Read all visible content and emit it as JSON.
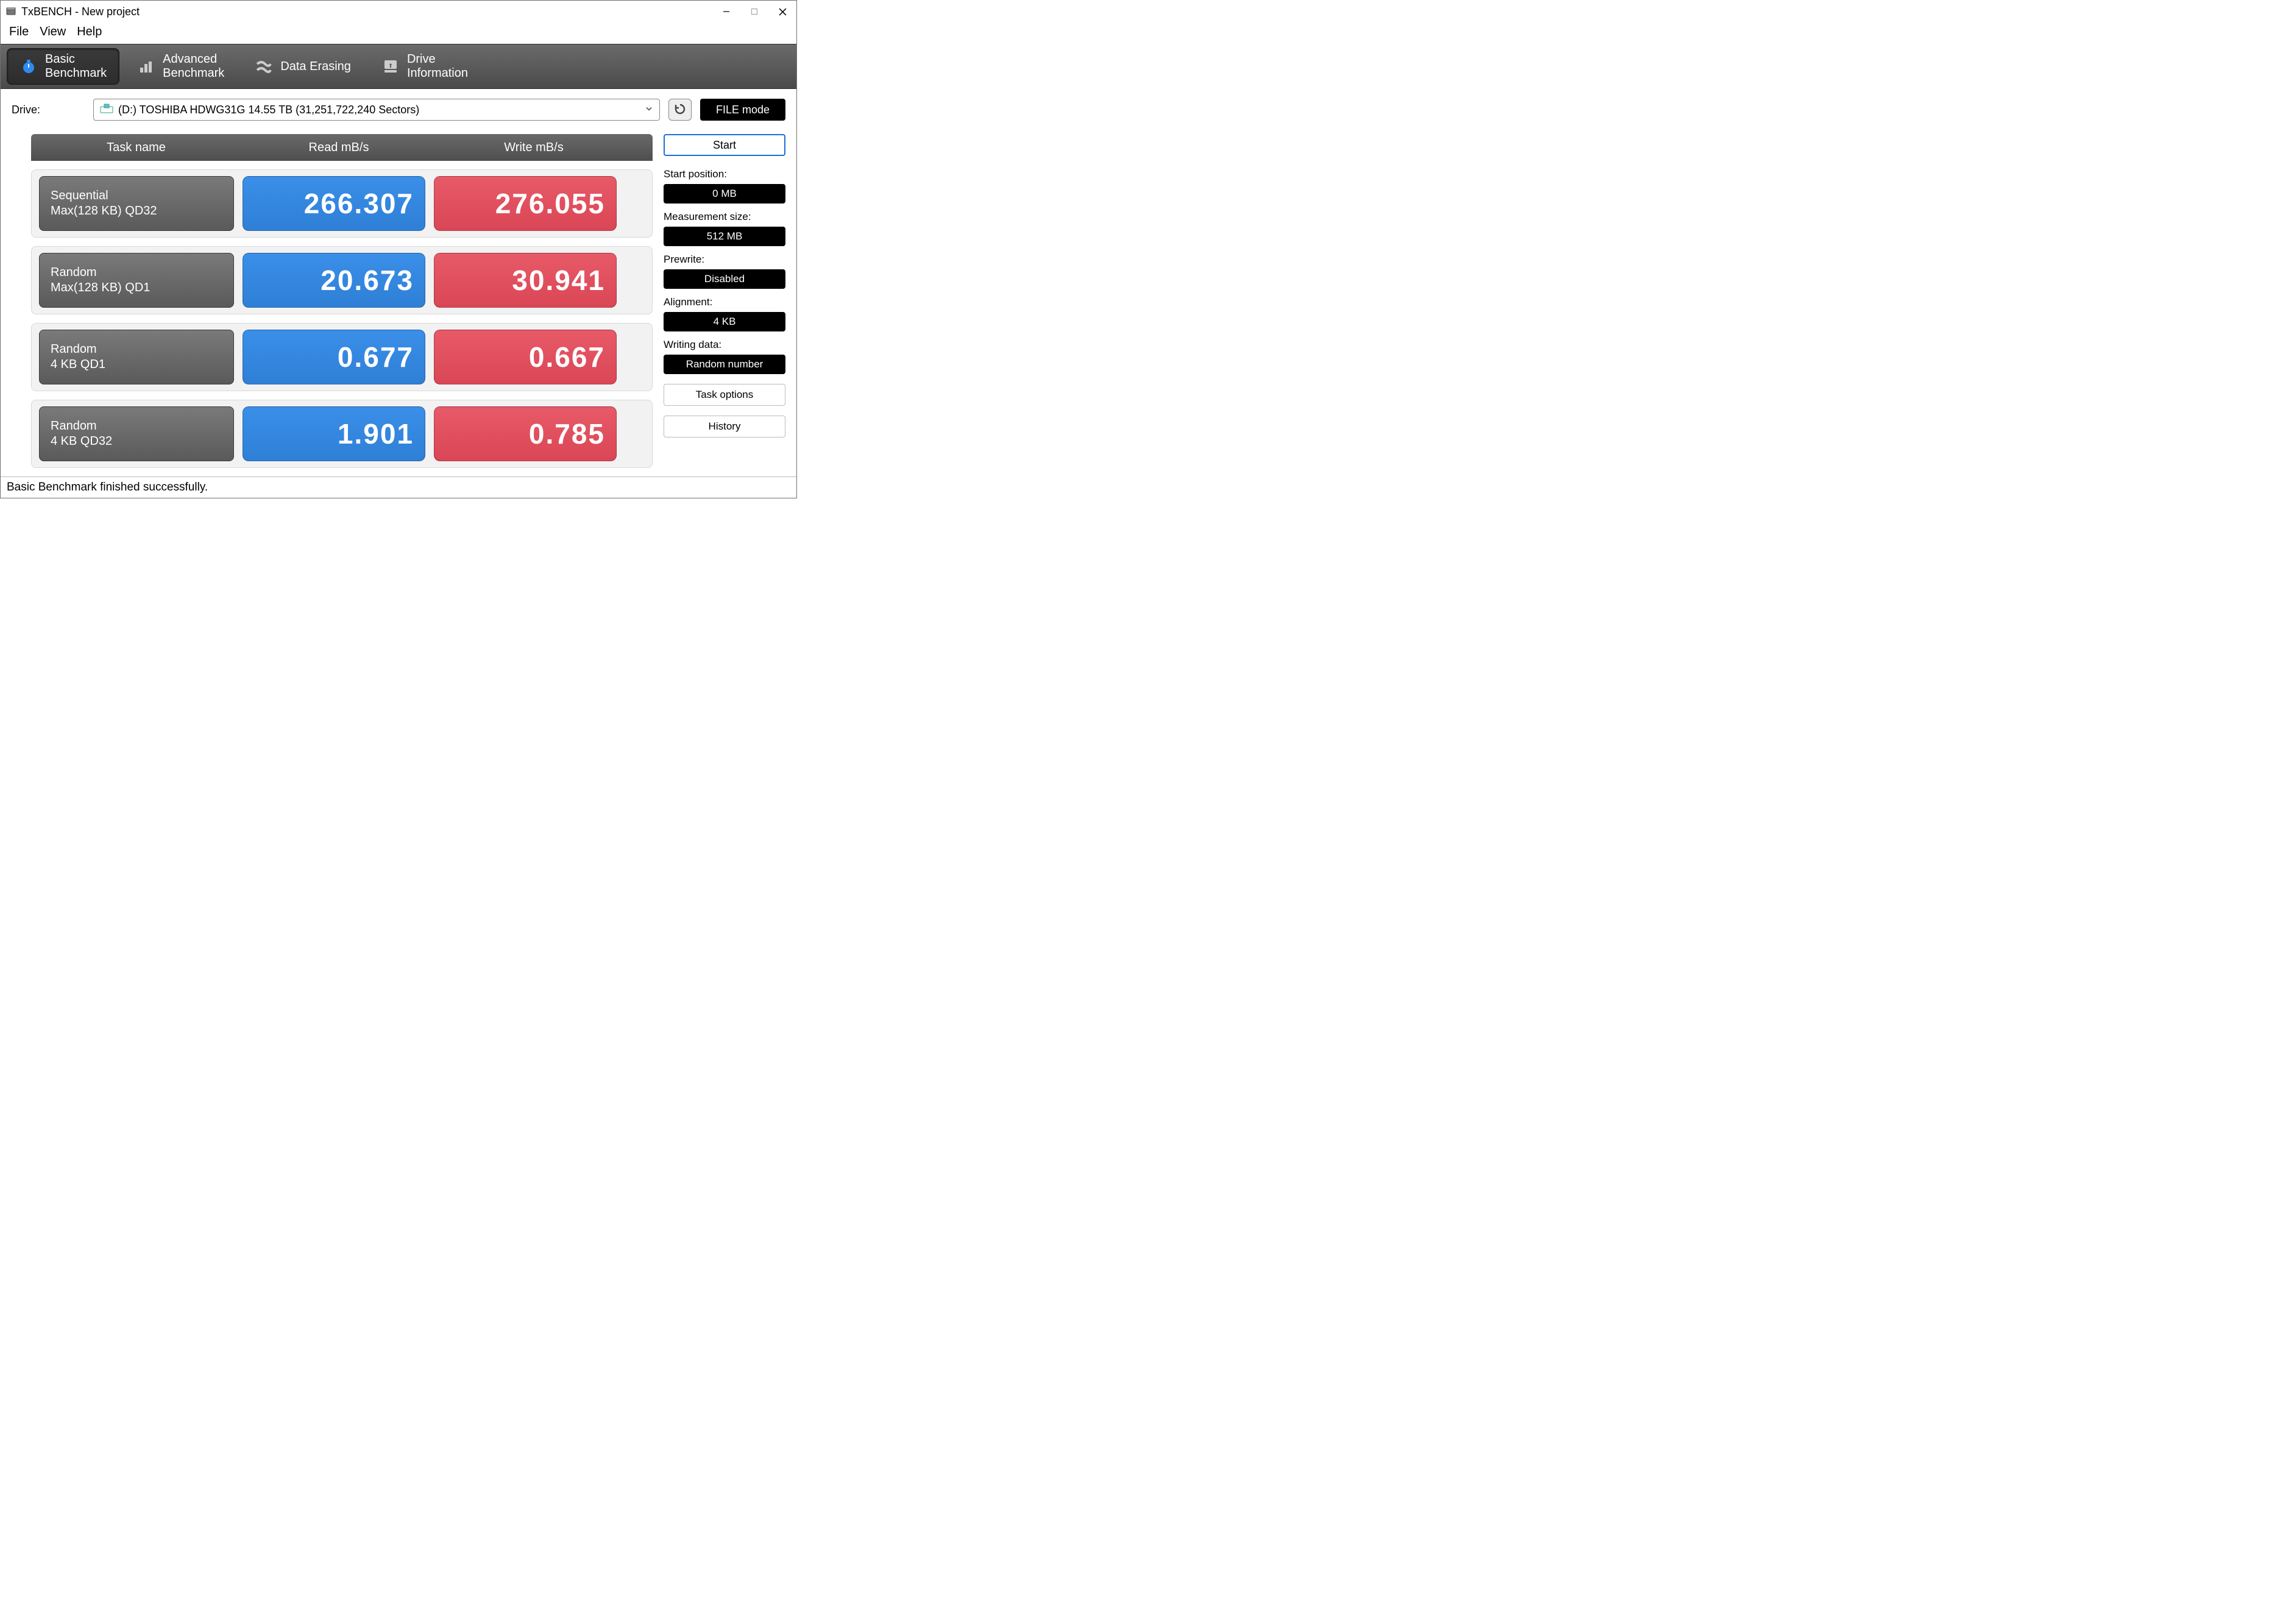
{
  "window": {
    "title": "TxBENCH - New project"
  },
  "menu": {
    "file": "File",
    "view": "View",
    "help": "Help"
  },
  "tabs": {
    "basic": {
      "line1": "Basic",
      "line2": "Benchmark"
    },
    "advanced": {
      "line1": "Advanced",
      "line2": "Benchmark"
    },
    "erase": {
      "label": "Data Erasing"
    },
    "drive": {
      "line1": "Drive",
      "line2": "Information"
    }
  },
  "drive": {
    "label": "Drive:",
    "selected": "(D:) TOSHIBA HDWG31G  14.55 TB (31,251,722,240 Sectors)",
    "filemode": "FILE mode"
  },
  "headers": {
    "task": "Task name",
    "read": "Read mB/s",
    "write": "Write mB/s"
  },
  "rows": [
    {
      "task_l1": "Sequential",
      "task_l2": "Max(128 KB) QD32",
      "read": "266.307",
      "write": "276.055"
    },
    {
      "task_l1": "Random",
      "task_l2": "Max(128 KB) QD1",
      "read": "20.673",
      "write": "30.941"
    },
    {
      "task_l1": "Random",
      "task_l2": "4 KB QD1",
      "read": "0.677",
      "write": "0.667"
    },
    {
      "task_l1": "Random",
      "task_l2": "4 KB QD32",
      "read": "1.901",
      "write": "0.785"
    }
  ],
  "side": {
    "start": "Start",
    "start_pos_label": "Start position:",
    "start_pos_value": "0 MB",
    "meas_label": "Measurement size:",
    "meas_value": "512 MB",
    "prewrite_label": "Prewrite:",
    "prewrite_value": "Disabled",
    "align_label": "Alignment:",
    "align_value": "4 KB",
    "wdata_label": "Writing data:",
    "wdata_value": "Random number",
    "task_options": "Task options",
    "history": "History"
  },
  "status": "Basic Benchmark finished successfully.",
  "chart_data": {
    "type": "table",
    "title": "Basic Benchmark",
    "columns": [
      "Task name",
      "Read mB/s",
      "Write mB/s"
    ],
    "rows": [
      [
        "Sequential Max(128 KB) QD32",
        266.307,
        276.055
      ],
      [
        "Random Max(128 KB) QD1",
        20.673,
        30.941
      ],
      [
        "Random 4 KB QD1",
        0.677,
        0.667
      ],
      [
        "Random 4 KB QD32",
        1.901,
        0.785
      ]
    ]
  }
}
